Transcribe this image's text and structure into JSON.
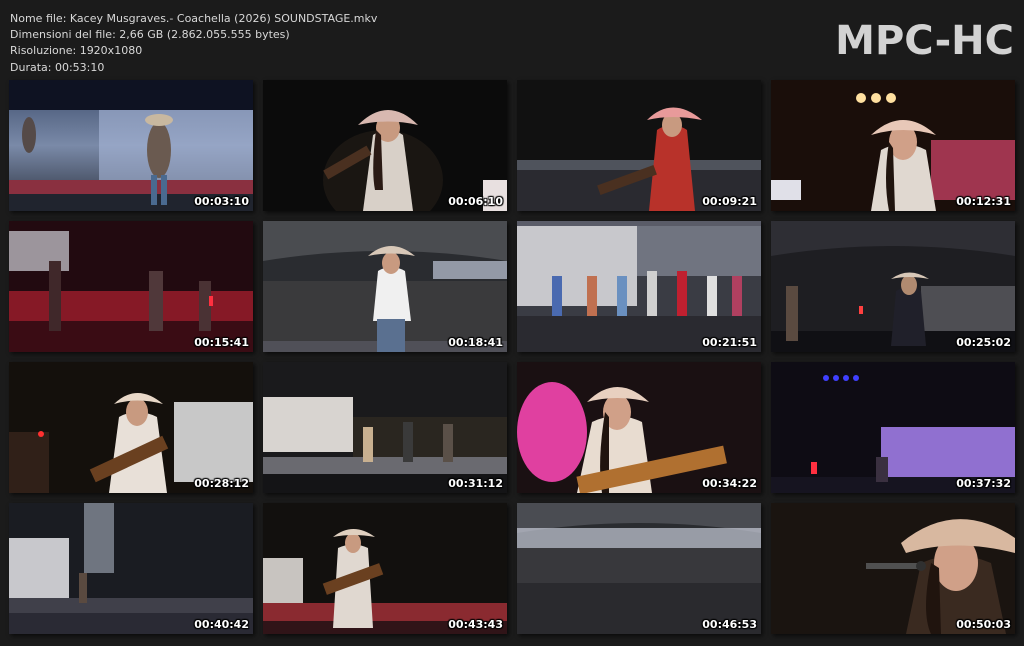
{
  "info": {
    "name_line": "Nome file: Kacey Musgraves.- Coachella (2026) SOUNDSTAGE.mkv",
    "size_line": "Dimensioni del file: 2,66 GB (2.862.055.555 bytes)",
    "resolution_line": "Risoluzione: 1920x1080",
    "duration_line": "Durata: 00:53:10"
  },
  "brand": "MPC-HC",
  "thumbnails": [
    {
      "time": "00:03:10",
      "scene": "stage-wide-blue"
    },
    {
      "time": "00:06:10",
      "scene": "singer-guitar-dark"
    },
    {
      "time": "00:09:21",
      "scene": "singer-red-crowd"
    },
    {
      "time": "00:12:31",
      "scene": "singer-closeup-lights"
    },
    {
      "time": "00:15:41",
      "scene": "stage-red-band"
    },
    {
      "time": "00:18:41",
      "scene": "singer-crowd-tent"
    },
    {
      "time": "00:21:51",
      "scene": "trailer-group"
    },
    {
      "time": "00:25:02",
      "scene": "stage-side-dark"
    },
    {
      "time": "00:28:12",
      "scene": "singer-guitar-trailer"
    },
    {
      "time": "00:31:12",
      "scene": "trailer-band-crowd"
    },
    {
      "time": "00:34:22",
      "scene": "singer-pink-closeup"
    },
    {
      "time": "00:37:32",
      "scene": "purple-trailer"
    },
    {
      "time": "00:40:42",
      "scene": "wide-stage-crowd"
    },
    {
      "time": "00:43:43",
      "scene": "singer-guitar-red-stage"
    },
    {
      "time": "00:46:53",
      "scene": "tent-crowd"
    },
    {
      "time": "00:50:03",
      "scene": "singer-hat-closeup"
    }
  ]
}
